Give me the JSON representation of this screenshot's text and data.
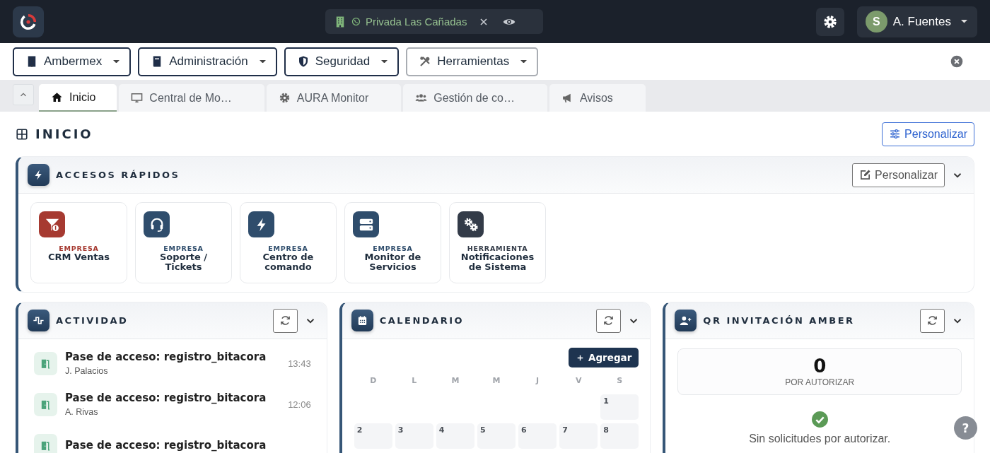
{
  "topbar": {
    "context": {
      "label": "Privada Las Cañadas"
    },
    "user": {
      "initial": "S",
      "name": "A. Fuentes"
    }
  },
  "menus": [
    {
      "label": "Ambermex",
      "kind": "primary"
    },
    {
      "label": "Administración",
      "kind": "primary"
    },
    {
      "label": "Seguridad",
      "kind": "primary"
    },
    {
      "label": "Herramientas",
      "kind": "secondary"
    }
  ],
  "tabs": [
    {
      "label": "Inicio",
      "selected": true
    },
    {
      "label": "Central de Mo…",
      "selected": false
    },
    {
      "label": "AURA Monitor",
      "selected": false
    },
    {
      "label": "Gestión de co…",
      "selected": false
    },
    {
      "label": "Avisos",
      "selected": false
    }
  ],
  "page": {
    "title": "INICIO",
    "customize_button": "Personalizar"
  },
  "quick_access": {
    "title": "ACCESOS RÁPIDOS",
    "customize_button": "Personalizar",
    "tiles": [
      {
        "category": "EMPRESA",
        "name": "CRM Ventas",
        "color": "#a63a31"
      },
      {
        "category": "EMPRESA",
        "name": "Soporte / Tickets",
        "color": "#2f4d6c"
      },
      {
        "category": "EMPRESA",
        "name": "Centro de comando",
        "color": "#2f4d6c"
      },
      {
        "category": "EMPRESA",
        "name": "Monitor de Servicios",
        "color": "#2f4d6c"
      },
      {
        "category": "HERRAMIENTA",
        "name": "Notificaciones de Sistema",
        "color": "#333b48"
      }
    ]
  },
  "activity": {
    "title": "ACTIVIDAD",
    "items": [
      {
        "title": "Pase de acceso: registro_bitacora",
        "user": "J. Palacios",
        "time": "13:43"
      },
      {
        "title": "Pase de acceso: registro_bitacora",
        "user": "A. Rivas",
        "time": "12:06"
      },
      {
        "title": "Pase de acceso: registro_bitacora"
      }
    ]
  },
  "calendar": {
    "title": "CALENDARIO",
    "add_button": "Agregar",
    "weekdays": [
      "D",
      "L",
      "M",
      "M",
      "J",
      "V",
      "S"
    ],
    "weeks": [
      {
        "partial": true,
        "days": [
          "1"
        ]
      },
      {
        "days": [
          "2",
          "3",
          "4",
          "5",
          "6",
          "7",
          "8"
        ]
      }
    ]
  },
  "qr_invitations": {
    "title": "QR INVITACIÓN AMBER",
    "count": "0",
    "count_label": "POR AUTORIZAR",
    "empty_message": "Sin solicitudes por autorizar."
  },
  "help_button": "?"
}
